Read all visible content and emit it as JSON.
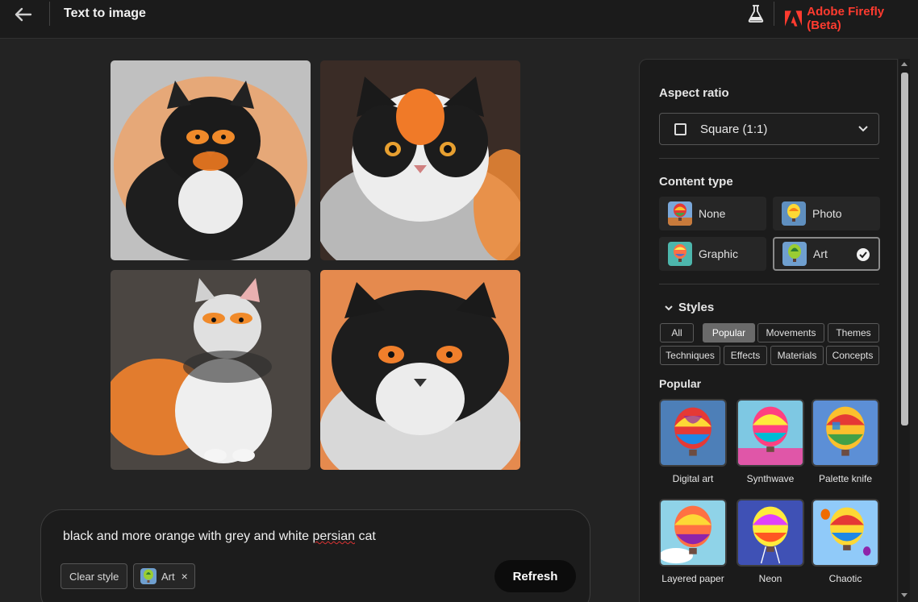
{
  "header": {
    "title": "Text to image",
    "brand": "Adobe Firefly (Beta)",
    "icons": [
      "back-arrow-icon",
      "beaker-icon",
      "adobe-logo-icon"
    ]
  },
  "prompt": {
    "text_before": "black and more orange with grey and white ",
    "text_misspelled": "persian",
    "text_after": " cat",
    "clear_style_label": "Clear style",
    "chip_label": "Art",
    "chip_remove": "×",
    "refresh_label": "Refresh"
  },
  "images": [
    {
      "bg": "#bdbdbd",
      "fur": "#f0913a"
    },
    {
      "bg": "#3a2c26",
      "fur": "#f08a36"
    },
    {
      "bg": "#4b4642",
      "fur": "#f3822c"
    },
    {
      "bg": "#e58a4e",
      "fur": "#f07f2b"
    }
  ],
  "panel": {
    "aspect_ratio_title": "Aspect ratio",
    "aspect_ratio_value": "Square (1:1)",
    "content_type_title": "Content type",
    "content_types": [
      {
        "label": "None",
        "selected": false
      },
      {
        "label": "Photo",
        "selected": false
      },
      {
        "label": "Graphic",
        "selected": false
      },
      {
        "label": "Art",
        "selected": true
      }
    ],
    "styles_title": "Styles",
    "style_tabs": [
      {
        "label": "All",
        "active": false
      },
      {
        "label": "Popular",
        "active": true
      },
      {
        "label": "Movements",
        "active": false
      },
      {
        "label": "Themes",
        "active": false
      },
      {
        "label": "Techniques",
        "active": false
      },
      {
        "label": "Effects",
        "active": false
      },
      {
        "label": "Materials",
        "active": false
      },
      {
        "label": "Concepts",
        "active": false
      }
    ],
    "popular_title": "Popular",
    "popular_styles": [
      {
        "label": "Digital art"
      },
      {
        "label": "Synthwave"
      },
      {
        "label": "Palette knife"
      },
      {
        "label": "Layered paper"
      },
      {
        "label": "Neon"
      },
      {
        "label": "Chaotic"
      }
    ]
  },
  "colors": {
    "brand_red": "#ff3b2f",
    "panel_bg": "#1b1b1b",
    "page_bg": "#232323"
  }
}
